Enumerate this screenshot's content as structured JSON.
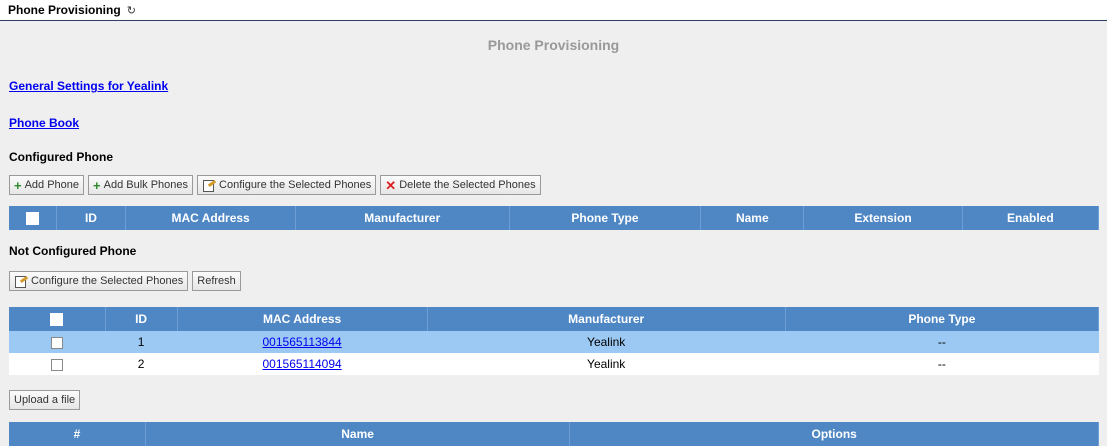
{
  "header": {
    "title": "Phone Provisioning",
    "refresh_icon": "refresh-icon"
  },
  "page_heading": "Phone Provisioning",
  "links": {
    "general_settings": "General Settings for Yealink",
    "phone_book": "Phone Book"
  },
  "configured": {
    "title": "Configured Phone",
    "buttons": {
      "add_phone": "Add Phone",
      "add_bulk": "Add Bulk Phones",
      "configure_selected": "Configure the Selected Phones",
      "delete_selected": "Delete the Selected Phones"
    },
    "columns": [
      "ID",
      "MAC Address",
      "Manufacturer",
      "Phone Type",
      "Name",
      "Extension",
      "Enabled"
    ]
  },
  "not_configured": {
    "title": "Not Configured Phone",
    "buttons": {
      "configure_selected": "Configure the Selected Phones",
      "refresh": "Refresh"
    },
    "columns": [
      "ID",
      "MAC Address",
      "Manufacturer",
      "Phone Type"
    ],
    "rows": [
      {
        "id": "1",
        "mac": "001565113844",
        "manufacturer": "Yealink",
        "phone_type": "--",
        "selected": true
      },
      {
        "id": "2",
        "mac": "001565114094",
        "manufacturer": "Yealink",
        "phone_type": "--",
        "selected": false
      }
    ]
  },
  "upload": {
    "button": "Upload a file",
    "columns": [
      "#",
      "Name",
      "Options"
    ]
  }
}
